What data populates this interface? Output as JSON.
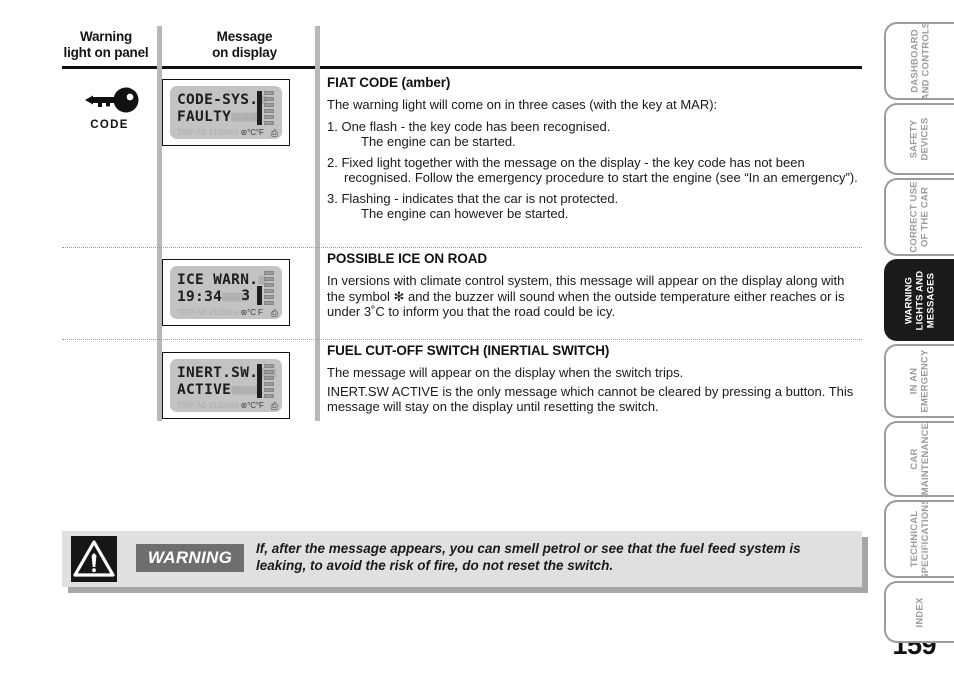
{
  "page": {
    "number": "159"
  },
  "table": {
    "headers": {
      "warning_light": "Warning\nlight on panel",
      "warning_light_line1": "Warning",
      "warning_light_line2": "light on panel",
      "message_line1": "Message",
      "message_line2": "on display"
    },
    "rows": [
      {
        "light": {
          "icon": "key-icon",
          "label": "CODE"
        },
        "display": {
          "line1": "CODE-SYS.",
          "line1_ghost": "",
          "line2": "FAULTY",
          "line2_right": "",
          "status": "TRIP AB I/100kmi",
          "status_units": "⊛°C°F"
        },
        "text": {
          "title": "FIAT CODE (amber)",
          "intro": "The warning light will come on in three cases (with the key at MAR):",
          "items": [
            {
              "num": "1.",
              "main": "One flash - the key code has been recognised.",
              "sub": "The engine can be started."
            },
            {
              "num": "2.",
              "main": "Fixed light together with the message on the display - the key code has not been recognised. Follow the emergency procedure to start the engine (see “In an emergency”).",
              "sub": ""
            },
            {
              "num": "3.",
              "main": "Flashing - indicates that the car is not protected.",
              "sub": "The engine can however be started."
            }
          ]
        }
      },
      {
        "light": {
          "icon": "",
          "label": ""
        },
        "display": {
          "line1": "ICE WARN.",
          "line1_ghost": "",
          "line2": "19:34",
          "line2_right": "3",
          "status": "TRIP AB I/100kmi",
          "status_units": "⊛°C F"
        },
        "text": {
          "title": "POSSIBLE ICE ON ROAD",
          "intro": "In versions with climate control system, this message will appear on the display along with the symbol ✻ and the buzzer will sound when the outside temperature either reaches or is under 3˚C to inform you that the road could be icy.",
          "items": []
        }
      },
      {
        "light": {
          "icon": "",
          "label": ""
        },
        "display": {
          "line1": "INERT.SW.",
          "line1_ghost": "",
          "line2": "ACTIVE",
          "line2_right": "",
          "status": "TRIP AB I/100kmi",
          "status_units": "⊛°C°F"
        },
        "text": {
          "title": "FUEL CUT-OFF SWITCH (INERTIAL SWITCH)",
          "intro": "The message will appear on the display when the switch trips.",
          "para2": "INERT.SW ACTIVE is the only message which cannot be cleared by pressing a button. This message will stay on the display until resetting the switch.",
          "items": []
        }
      }
    ]
  },
  "warning_box": {
    "icon": "warning-triangle-icon",
    "label": "WARNING",
    "text": "If, after the message appears, you can smell petrol or see that the fuel feed system is leaking, to avoid the risk of fire, do not reset the switch."
  },
  "sidebar": {
    "tabs": [
      {
        "line1": "DASHBOARD",
        "line2": "AND CONTROLS",
        "active": false
      },
      {
        "line1": "SAFETY",
        "line2": "DEVICES",
        "active": false
      },
      {
        "line1": "CORRECT USE",
        "line2": "OF THE CAR",
        "active": false
      },
      {
        "line1": "WARNING",
        "line2": "LIGHTS AND",
        "line3": "MESSAGES",
        "active": true
      },
      {
        "line1": "IN AN",
        "line2": "EMERGENCY",
        "active": false
      },
      {
        "line1": "CAR",
        "line2": "MAINTENANCE",
        "active": false
      },
      {
        "line1": "TECHNICAL",
        "line2": "SPECIFICATIONS",
        "active": false
      },
      {
        "line1": "INDEX",
        "line2": "",
        "active": false
      }
    ]
  },
  "colors": {
    "rule": "#111111",
    "divider": "#b8b8b8",
    "lcd_bg": "#c3c3c3",
    "warn_box_bg": "#e0e0e0",
    "warn_label_bg": "#6e6e6e",
    "tab_inactive": "#9c9c9c",
    "tab_active": "#1b1b1b"
  }
}
